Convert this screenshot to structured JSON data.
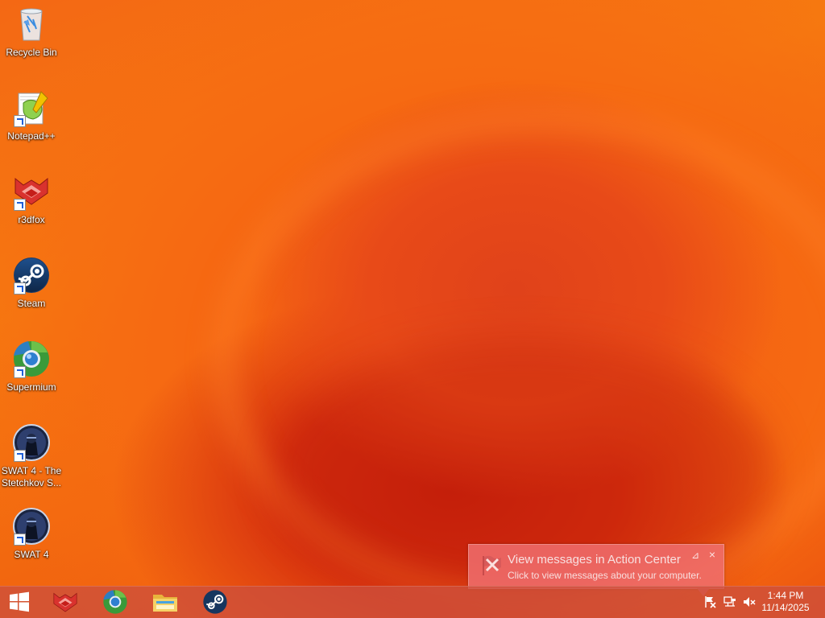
{
  "desktop": {
    "icons": [
      {
        "label": "Recycle Bin",
        "icon": "recycle-bin-icon"
      },
      {
        "label": "Notepad++",
        "icon": "notepad-plus-plus-icon"
      },
      {
        "label": "r3dfox",
        "icon": "r3dfox-icon"
      },
      {
        "label": "Steam",
        "icon": "steam-icon"
      },
      {
        "label": "Supermium",
        "icon": "supermium-icon"
      },
      {
        "label": "SWAT 4 - The Stetchkov S...",
        "icon": "swat4-stetchkov-icon"
      },
      {
        "label": "SWAT 4",
        "icon": "swat4-icon"
      }
    ]
  },
  "notification": {
    "title": "View messages in Action Center",
    "body": "Click to view messages about your computer.",
    "pin_glyph": "⊿",
    "close_glyph": "×"
  },
  "taskbar": {
    "pinned": [
      {
        "name": "r3dfox",
        "icon": "r3dfox-icon"
      },
      {
        "name": "Supermium",
        "icon": "supermium-icon"
      },
      {
        "name": "File Explorer",
        "icon": "folder-icon"
      },
      {
        "name": "Steam",
        "icon": "steam-icon"
      }
    ],
    "tray": {
      "time": "1:44 PM",
      "date": "11/14/2025"
    }
  },
  "colors": {
    "wallpaper_main": "#f46814",
    "taskbar": "#cd503c",
    "notification": "#f06e6e"
  }
}
